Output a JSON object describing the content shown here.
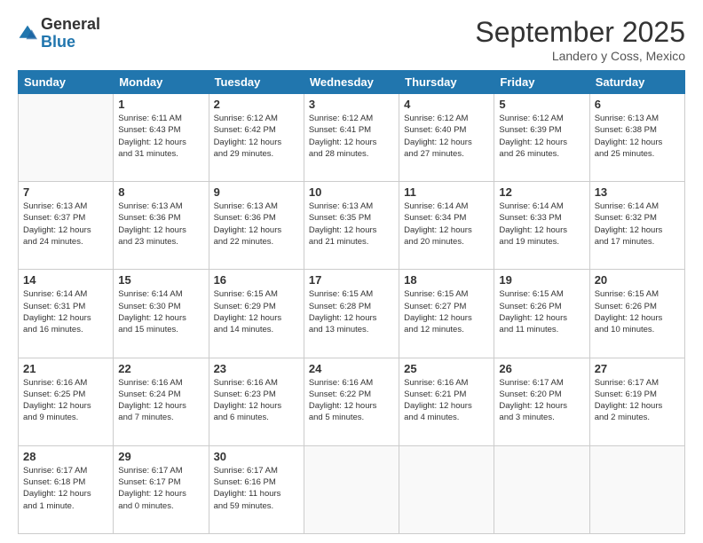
{
  "logo": {
    "general": "General",
    "blue": "Blue"
  },
  "header": {
    "month_title": "September 2025",
    "subtitle": "Landero y Coss, Mexico"
  },
  "days_of_week": [
    "Sunday",
    "Monday",
    "Tuesday",
    "Wednesday",
    "Thursday",
    "Friday",
    "Saturday"
  ],
  "weeks": [
    [
      {
        "day": "",
        "info": ""
      },
      {
        "day": "1",
        "info": "Sunrise: 6:11 AM\nSunset: 6:43 PM\nDaylight: 12 hours\nand 31 minutes."
      },
      {
        "day": "2",
        "info": "Sunrise: 6:12 AM\nSunset: 6:42 PM\nDaylight: 12 hours\nand 29 minutes."
      },
      {
        "day": "3",
        "info": "Sunrise: 6:12 AM\nSunset: 6:41 PM\nDaylight: 12 hours\nand 28 minutes."
      },
      {
        "day": "4",
        "info": "Sunrise: 6:12 AM\nSunset: 6:40 PM\nDaylight: 12 hours\nand 27 minutes."
      },
      {
        "day": "5",
        "info": "Sunrise: 6:12 AM\nSunset: 6:39 PM\nDaylight: 12 hours\nand 26 minutes."
      },
      {
        "day": "6",
        "info": "Sunrise: 6:13 AM\nSunset: 6:38 PM\nDaylight: 12 hours\nand 25 minutes."
      }
    ],
    [
      {
        "day": "7",
        "info": "Sunrise: 6:13 AM\nSunset: 6:37 PM\nDaylight: 12 hours\nand 24 minutes."
      },
      {
        "day": "8",
        "info": "Sunrise: 6:13 AM\nSunset: 6:36 PM\nDaylight: 12 hours\nand 23 minutes."
      },
      {
        "day": "9",
        "info": "Sunrise: 6:13 AM\nSunset: 6:36 PM\nDaylight: 12 hours\nand 22 minutes."
      },
      {
        "day": "10",
        "info": "Sunrise: 6:13 AM\nSunset: 6:35 PM\nDaylight: 12 hours\nand 21 minutes."
      },
      {
        "day": "11",
        "info": "Sunrise: 6:14 AM\nSunset: 6:34 PM\nDaylight: 12 hours\nand 20 minutes."
      },
      {
        "day": "12",
        "info": "Sunrise: 6:14 AM\nSunset: 6:33 PM\nDaylight: 12 hours\nand 19 minutes."
      },
      {
        "day": "13",
        "info": "Sunrise: 6:14 AM\nSunset: 6:32 PM\nDaylight: 12 hours\nand 17 minutes."
      }
    ],
    [
      {
        "day": "14",
        "info": "Sunrise: 6:14 AM\nSunset: 6:31 PM\nDaylight: 12 hours\nand 16 minutes."
      },
      {
        "day": "15",
        "info": "Sunrise: 6:14 AM\nSunset: 6:30 PM\nDaylight: 12 hours\nand 15 minutes."
      },
      {
        "day": "16",
        "info": "Sunrise: 6:15 AM\nSunset: 6:29 PM\nDaylight: 12 hours\nand 14 minutes."
      },
      {
        "day": "17",
        "info": "Sunrise: 6:15 AM\nSunset: 6:28 PM\nDaylight: 12 hours\nand 13 minutes."
      },
      {
        "day": "18",
        "info": "Sunrise: 6:15 AM\nSunset: 6:27 PM\nDaylight: 12 hours\nand 12 minutes."
      },
      {
        "day": "19",
        "info": "Sunrise: 6:15 AM\nSunset: 6:26 PM\nDaylight: 12 hours\nand 11 minutes."
      },
      {
        "day": "20",
        "info": "Sunrise: 6:15 AM\nSunset: 6:26 PM\nDaylight: 12 hours\nand 10 minutes."
      }
    ],
    [
      {
        "day": "21",
        "info": "Sunrise: 6:16 AM\nSunset: 6:25 PM\nDaylight: 12 hours\nand 9 minutes."
      },
      {
        "day": "22",
        "info": "Sunrise: 6:16 AM\nSunset: 6:24 PM\nDaylight: 12 hours\nand 7 minutes."
      },
      {
        "day": "23",
        "info": "Sunrise: 6:16 AM\nSunset: 6:23 PM\nDaylight: 12 hours\nand 6 minutes."
      },
      {
        "day": "24",
        "info": "Sunrise: 6:16 AM\nSunset: 6:22 PM\nDaylight: 12 hours\nand 5 minutes."
      },
      {
        "day": "25",
        "info": "Sunrise: 6:16 AM\nSunset: 6:21 PM\nDaylight: 12 hours\nand 4 minutes."
      },
      {
        "day": "26",
        "info": "Sunrise: 6:17 AM\nSunset: 6:20 PM\nDaylight: 12 hours\nand 3 minutes."
      },
      {
        "day": "27",
        "info": "Sunrise: 6:17 AM\nSunset: 6:19 PM\nDaylight: 12 hours\nand 2 minutes."
      }
    ],
    [
      {
        "day": "28",
        "info": "Sunrise: 6:17 AM\nSunset: 6:18 PM\nDaylight: 12 hours\nand 1 minute."
      },
      {
        "day": "29",
        "info": "Sunrise: 6:17 AM\nSunset: 6:17 PM\nDaylight: 12 hours\nand 0 minutes."
      },
      {
        "day": "30",
        "info": "Sunrise: 6:17 AM\nSunset: 6:16 PM\nDaylight: 11 hours\nand 59 minutes."
      },
      {
        "day": "",
        "info": ""
      },
      {
        "day": "",
        "info": ""
      },
      {
        "day": "",
        "info": ""
      },
      {
        "day": "",
        "info": ""
      }
    ]
  ]
}
